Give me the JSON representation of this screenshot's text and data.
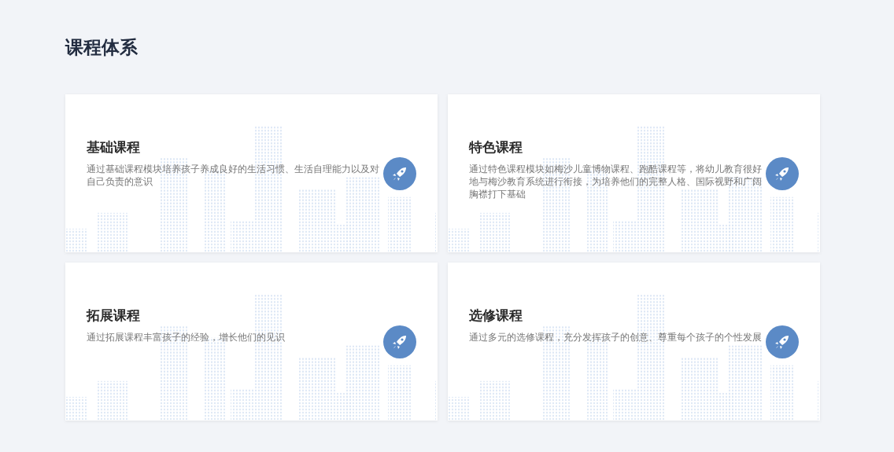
{
  "heading": "课程体系",
  "courses": [
    {
      "title": "基础课程",
      "description": "通过基础课程模块培养孩子养成良好的生活习惯、生活自理能力以及对自己负责的意识"
    },
    {
      "title": "特色课程",
      "description": "通过特色课程模块如梅沙儿童博物课程、跑酷课程等，将幼儿教育很好地与梅沙教育系统进行衔接，为培养他们的完整人格、国际视野和广阔胸襟打下基础"
    },
    {
      "title": "拓展课程",
      "description": "通过拓展课程丰富孩子的经验，增长他们的见识"
    },
    {
      "title": "选修课程",
      "description": "通过多元的选修课程，充分发挥孩子的创意、尊重每个孩子的个性发展"
    }
  ]
}
